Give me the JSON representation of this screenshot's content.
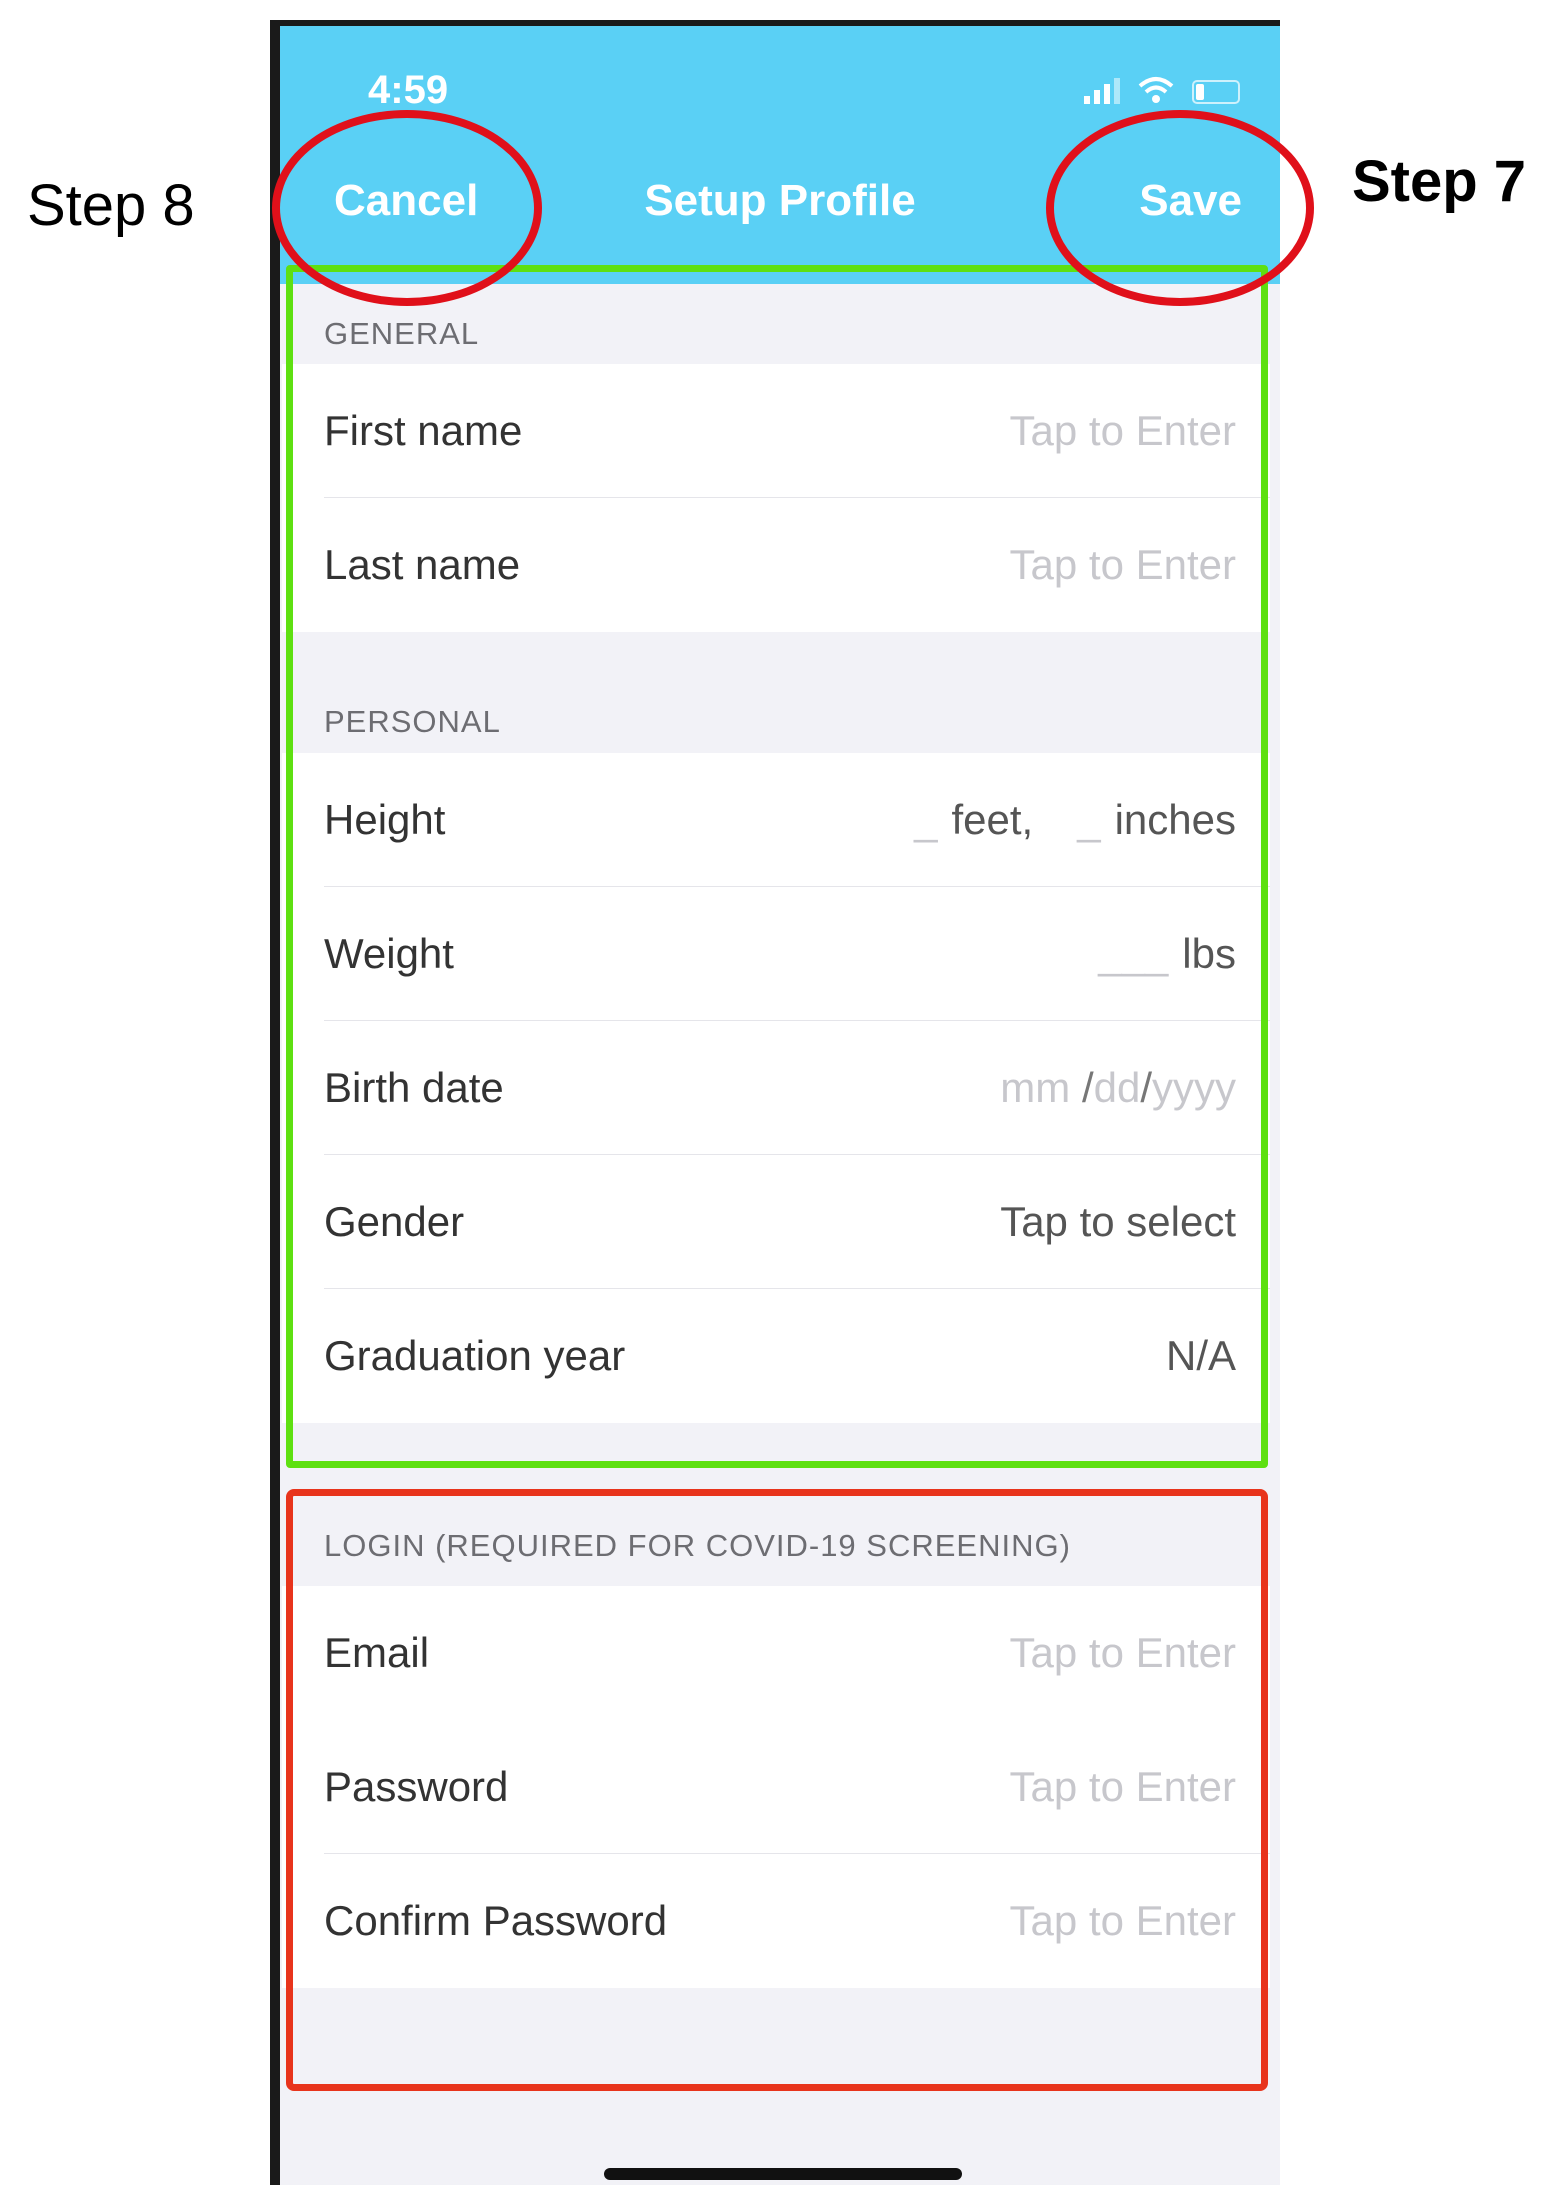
{
  "annotations": {
    "step8": "Step 8",
    "step7": "Step 7",
    "ring_color": "#e0101a",
    "general_personal_box_color": "#5ee011",
    "login_box_color": "#e8341c"
  },
  "status_bar": {
    "time": "4:59",
    "icons": [
      "cellular-signal-icon",
      "wifi-icon",
      "battery-icon"
    ]
  },
  "navbar": {
    "cancel_label": "Cancel",
    "title": "Setup Profile",
    "save_label": "Save",
    "background": "#5ad0f5"
  },
  "sections": {
    "general": {
      "header": "GENERAL",
      "first_name": {
        "label": "First name",
        "placeholder": "Tap to Enter"
      },
      "last_name": {
        "label": "Last name",
        "placeholder": "Tap to Enter"
      }
    },
    "personal": {
      "header": "PERSONAL",
      "height": {
        "label": "Height",
        "feet_blank": "_",
        "feet_unit": "feet,",
        "inches_blank": "_",
        "inches_unit": "inches"
      },
      "weight": {
        "label": "Weight",
        "blank": "___",
        "unit": "lbs"
      },
      "birth_date": {
        "label": "Birth date",
        "mm": "mm",
        "dd": "dd",
        "yyyy": "yyyy",
        "sep": "/"
      },
      "gender": {
        "label": "Gender",
        "value": "Tap to select"
      },
      "graduation_year": {
        "label": "Graduation year",
        "value": "N/A"
      }
    },
    "login": {
      "header": "LOGIN (REQUIRED FOR COVID-19 SCREENING)",
      "email": {
        "label": "Email",
        "placeholder": "Tap to Enter"
      },
      "password": {
        "label": "Password",
        "placeholder": "Tap to Enter"
      },
      "confirm_password": {
        "label": "Confirm Password",
        "placeholder": "Tap to Enter"
      }
    }
  }
}
